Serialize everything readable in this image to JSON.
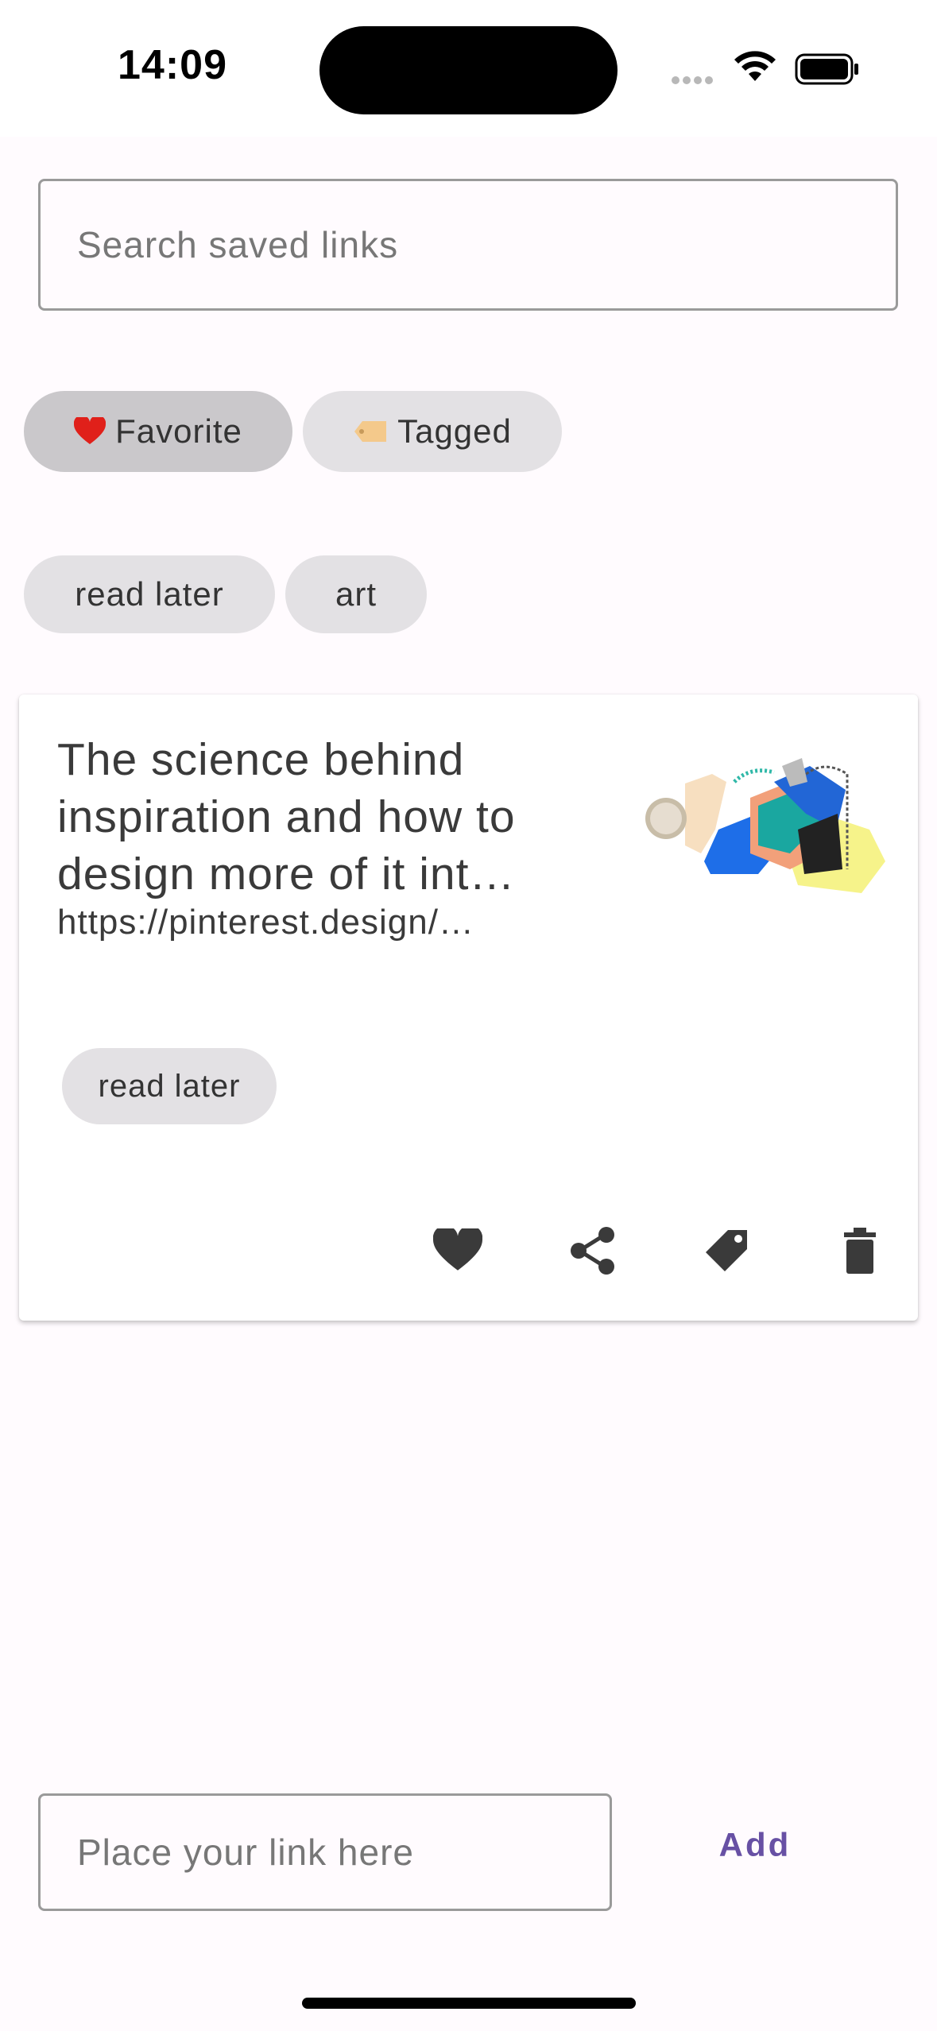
{
  "status_bar": {
    "time": "14:09"
  },
  "search": {
    "placeholder": "Search saved links"
  },
  "filters": [
    {
      "emoji": "❤️",
      "label": "Favorite",
      "selected": true
    },
    {
      "emoji": "🏷️",
      "label": "Tagged",
      "selected": false
    }
  ],
  "tags": [
    "read later",
    "art"
  ],
  "card": {
    "title": "The science behind inspiration and how to design more of it int…",
    "url": "https://pinterest.design/…",
    "tag": "read later",
    "actions": [
      "heart-icon",
      "share-icon",
      "tag-icon",
      "trash-icon"
    ]
  },
  "link_input": {
    "placeholder": "Place your link here"
  },
  "add_button": {
    "label": "Add"
  },
  "colors": {
    "background": "#fffbfe",
    "accent": "#6750a4",
    "chip": "#e3e1e4",
    "chip_selected": "#cac8cb"
  }
}
